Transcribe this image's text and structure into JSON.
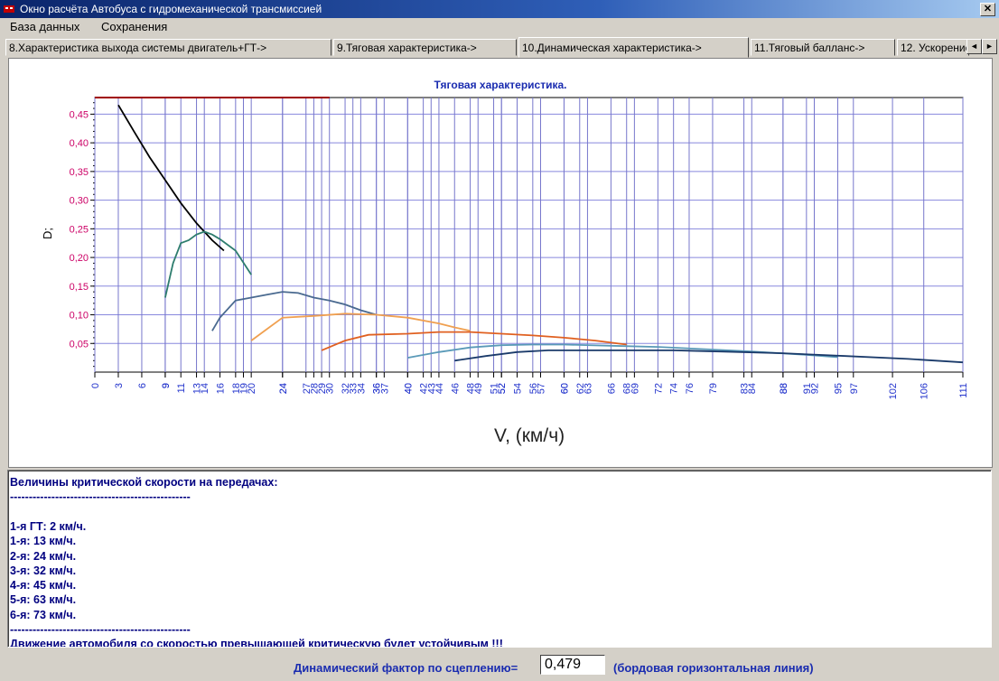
{
  "window": {
    "title": "Окно расчёта Автобуса с гидромеханической трансмиссией",
    "close_glyph": "✕",
    "icon": "app-icon"
  },
  "menu": {
    "items": [
      "База данных",
      "Сохранения"
    ]
  },
  "tabs": {
    "items": [
      {
        "label": "8.Характеристика выхода системы двигатель+ГТ->"
      },
      {
        "label": "9.Тяговая характеристика->"
      },
      {
        "label": "10.Динамическая характеристика->"
      },
      {
        "label": "11.Тяговый балланс->"
      },
      {
        "label": "12. Ускорение"
      }
    ],
    "active_index": 2,
    "scroll_left_glyph": "◄",
    "scroll_right_glyph": "►"
  },
  "chart_data": {
    "type": "line",
    "title": "Тяговая характеристика.",
    "xlabel": "V, (км/ч)",
    "ylabel": "D;",
    "xlim": [
      0,
      111
    ],
    "ylim": [
      0,
      0.479
    ],
    "y_ticks": [
      0.05,
      0.1,
      0.15,
      0.2,
      0.25,
      0.3,
      0.35,
      0.4,
      0.45
    ],
    "y_tick_labels": [
      "0,05",
      "0,10",
      "0,15",
      "0,20",
      "0,25",
      "0,30",
      "0,35",
      "0,40",
      "0,45"
    ],
    "x_tick_labels": [
      0,
      3,
      6,
      9,
      9,
      11,
      13,
      14,
      16,
      18,
      19,
      20,
      24,
      24,
      27,
      28,
      29,
      30,
      32,
      33,
      34,
      36,
      36,
      37,
      40,
      40,
      42,
      43,
      44,
      46,
      48,
      49,
      51,
      52,
      52,
      54,
      56,
      57,
      60,
      60,
      62,
      63,
      66,
      68,
      69,
      72,
      74,
      76,
      79,
      83,
      84,
      88,
      88,
      91,
      92,
      95,
      97,
      102,
      106,
      111
    ],
    "grid": true,
    "grip_line": {
      "value": 0.479,
      "x_to": 30,
      "color": "#a00000"
    },
    "series": [
      {
        "color": "#000000",
        "x": [
          3,
          5,
          7,
          9,
          11,
          13,
          15,
          16.5
        ],
        "y": [
          0.466,
          0.42,
          0.375,
          0.335,
          0.295,
          0.26,
          0.23,
          0.212
        ]
      },
      {
        "color": "#2e7d6e",
        "x": [
          9,
          10,
          11,
          12,
          13,
          14,
          15,
          16,
          18,
          20
        ],
        "y": [
          0.13,
          0.19,
          0.225,
          0.23,
          0.24,
          0.245,
          0.24,
          0.232,
          0.212,
          0.17
        ]
      },
      {
        "color": "#4a6a90",
        "x": [
          15,
          16,
          18,
          20,
          22,
          24,
          26,
          28,
          30,
          32,
          34,
          36
        ],
        "y": [
          0.072,
          0.095,
          0.125,
          0.13,
          0.135,
          0.14,
          0.138,
          0.13,
          0.125,
          0.118,
          0.108,
          0.1
        ]
      },
      {
        "color": "#f0a050",
        "x": [
          20,
          22,
          24,
          28,
          32,
          36,
          40,
          44,
          46,
          48
        ],
        "y": [
          0.055,
          0.075,
          0.095,
          0.098,
          0.102,
          0.1,
          0.095,
          0.085,
          0.078,
          0.072
        ]
      },
      {
        "color": "#e06020",
        "x": [
          29,
          32,
          35,
          40,
          44,
          48,
          52,
          56,
          60,
          64,
          68
        ],
        "y": [
          0.038,
          0.055,
          0.065,
          0.067,
          0.07,
          0.07,
          0.067,
          0.064,
          0.06,
          0.055,
          0.048
        ]
      },
      {
        "color": "#5a9ab8",
        "x": [
          40,
          44,
          48,
          52,
          56,
          60,
          66,
          72,
          78,
          84,
          90,
          95
        ],
        "y": [
          0.025,
          0.035,
          0.043,
          0.047,
          0.048,
          0.048,
          0.046,
          0.044,
          0.04,
          0.036,
          0.031,
          0.026
        ]
      },
      {
        "color": "#1a3a6a",
        "x": [
          46,
          50,
          54,
          58,
          62,
          68,
          74,
          80,
          88,
          96,
          104,
          111
        ],
        "y": [
          0.02,
          0.028,
          0.035,
          0.038,
          0.038,
          0.038,
          0.038,
          0.036,
          0.033,
          0.028,
          0.023,
          0.017
        ]
      }
    ]
  },
  "output": {
    "lines": [
      "Величины критической скорости на передачах:",
      "------------------------------------------------",
      "",
      "1-я ГТ: 2 км/ч.",
      "1-я: 13 км/ч.",
      "2-я: 24 км/ч.",
      "3-я: 32 км/ч.",
      "4-я: 45 км/ч.",
      "5-я: 63 км/ч.",
      "6-я: 73 км/ч.",
      "------------------------------------------------",
      "Движение автомобиля со скоростью превышающей критическую будет устойчивым !!!"
    ]
  },
  "footer": {
    "label": "Динамический фактор по сцеплению=",
    "value": "0,479",
    "note": "(бордовая горизонтальная линия)"
  }
}
